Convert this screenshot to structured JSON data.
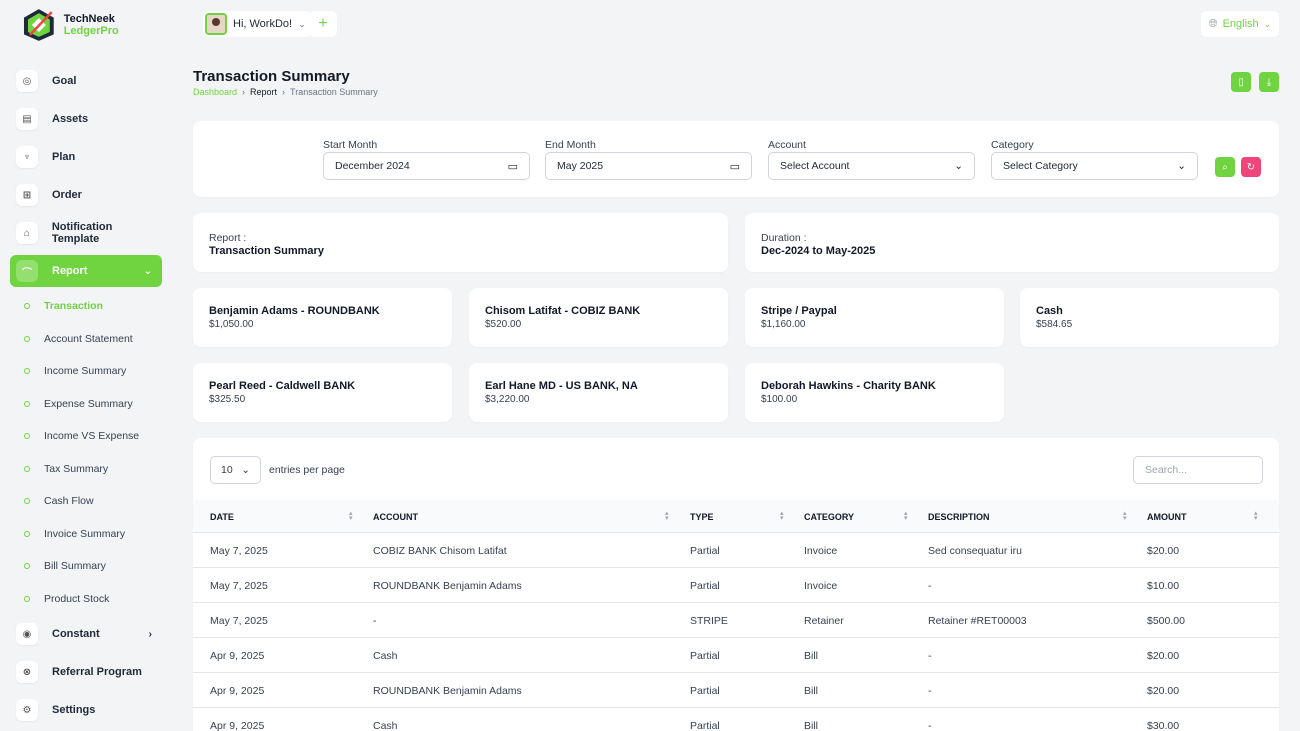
{
  "app": {
    "name_part1": "TechNeek",
    "name_part2": "LedgerPro"
  },
  "topbar": {
    "greeting": "Hi, WorkDo!",
    "language": "English"
  },
  "sidebar": {
    "items_top": [
      {
        "label": "Goal",
        "icon": "target-icon"
      },
      {
        "label": "Assets",
        "icon": "calculator-icon"
      },
      {
        "label": "Plan",
        "icon": "trophy-icon"
      },
      {
        "label": "Order",
        "icon": "cart-icon"
      },
      {
        "label": "Notification Template",
        "icon": "bell-icon"
      }
    ],
    "report": {
      "label": "Report"
    },
    "report_sub": [
      "Transaction",
      "Account Statement",
      "Income Summary",
      "Expense Summary",
      "Income VS Expense",
      "Tax Summary",
      "Cash Flow",
      "Invoice Summary",
      "Bill Summary",
      "Product Stock"
    ],
    "items_bottom": [
      {
        "label": "Constant"
      },
      {
        "label": "Referral Program"
      },
      {
        "label": "Settings"
      }
    ]
  },
  "header": {
    "title": "Transaction Summary",
    "breadcrumb": [
      "Dashboard",
      "Report",
      "Transaction Summary"
    ]
  },
  "filters": {
    "start_month": {
      "label": "Start Month",
      "value": "December 2024"
    },
    "end_month": {
      "label": "End Month",
      "value": "May 2025"
    },
    "account": {
      "label": "Account",
      "value": "Select Account"
    },
    "category": {
      "label": "Category",
      "value": "Select Category"
    }
  },
  "summary": {
    "report_label": "Report :",
    "report_value": "Transaction Summary",
    "duration_label": "Duration :",
    "duration_value": "Dec-2024 to May-2025"
  },
  "accounts": [
    {
      "name": "Benjamin Adams - ROUNDBANK",
      "balance": "$1,050.00"
    },
    {
      "name": "Chisom Latifat - COBIZ BANK",
      "balance": "$520.00"
    },
    {
      "name": "Stripe / Paypal",
      "balance": "$1,160.00"
    },
    {
      "name": "Cash",
      "balance": "$584.65"
    },
    {
      "name": "Pearl Reed - Caldwell BANK",
      "balance": "$325.50"
    },
    {
      "name": "Earl Hane MD - US BANK, NA",
      "balance": "$3,220.00"
    },
    {
      "name": "Deborah Hawkins - Charity BANK",
      "balance": "$100.00"
    }
  ],
  "table": {
    "per_page": "10",
    "per_page_label": "entries per page",
    "search_placeholder": "Search...",
    "columns": [
      "DATE",
      "ACCOUNT",
      "TYPE",
      "CATEGORY",
      "DESCRIPTION",
      "AMOUNT"
    ],
    "rows": [
      [
        "May 7, 2025",
        "COBIZ BANK Chisom Latifat",
        "Partial",
        "Invoice",
        "Sed consequatur iru",
        "$20.00"
      ],
      [
        "May 7, 2025",
        "ROUNDBANK Benjamin Adams",
        "Partial",
        "Invoice",
        "-",
        "$10.00"
      ],
      [
        "May 7, 2025",
        "-",
        "STRIPE",
        "Retainer",
        "Retainer #RET00003",
        "$500.00"
      ],
      [
        "Apr 9, 2025",
        "Cash",
        "Partial",
        "Bill",
        "-",
        "$20.00"
      ],
      [
        "Apr 9, 2025",
        "ROUNDBANK Benjamin Adams",
        "Partial",
        "Bill",
        "-",
        "$20.00"
      ],
      [
        "Apr 9, 2025",
        "Cash",
        "Partial",
        "Bill",
        "-",
        "$30.00"
      ]
    ]
  },
  "colors": {
    "accent": "#6fd43f",
    "danger": "#f0457a"
  }
}
